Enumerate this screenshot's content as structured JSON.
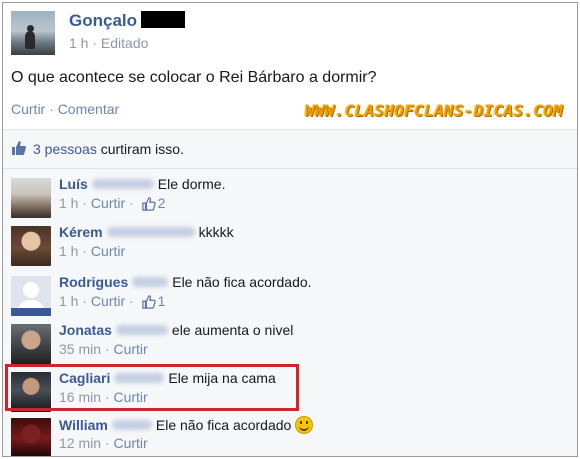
{
  "post": {
    "author": "Gonçalo",
    "time": "1 h",
    "meta_sep": "·",
    "edited": "Editado",
    "text": "O que acontece se colocar o Rei Bárbaro a dormir?",
    "actions": {
      "like": "Curtir",
      "sep": "·",
      "comment": "Comentar"
    },
    "watermark": "WWW.CLASHOFCLANS-DICAS.COM"
  },
  "likes": {
    "count_text": "3 pessoas",
    "rest": "curtiram isso."
  },
  "comments": [
    {
      "name": "Luís",
      "text": "Ele dorme.",
      "time": "1 h",
      "sep": "·",
      "like": "Curtir",
      "likes": "2"
    },
    {
      "name": "Kérem",
      "text": "kkkkk",
      "time": "1 h",
      "sep": "·",
      "like": "Curtir",
      "likes": ""
    },
    {
      "name": "Rodrigues",
      "text": "Ele não fica acordado.",
      "time": "1 h",
      "sep": "·",
      "like": "Curtir",
      "likes": "1"
    },
    {
      "name": "Jonatas",
      "text": "ele aumenta o nivel",
      "time": "35 min",
      "sep": "·",
      "like": "Curtir",
      "likes": ""
    },
    {
      "name": "Cagliari",
      "text": "Ele mija na cama",
      "time": "16 min",
      "sep": "·",
      "like": "Curtir",
      "likes": ""
    },
    {
      "name": "William",
      "text": "Ele não fica acordado",
      "time": "12 min",
      "sep": "·",
      "like": "Curtir",
      "likes": ""
    }
  ],
  "colors": {
    "link": "#3b5998",
    "muted": "#9197a3",
    "highlight": "#d3232a",
    "watermark": "#f2a000"
  },
  "icons": {
    "like": "thumbs-up-icon",
    "emoji": "grinning-face-icon"
  }
}
